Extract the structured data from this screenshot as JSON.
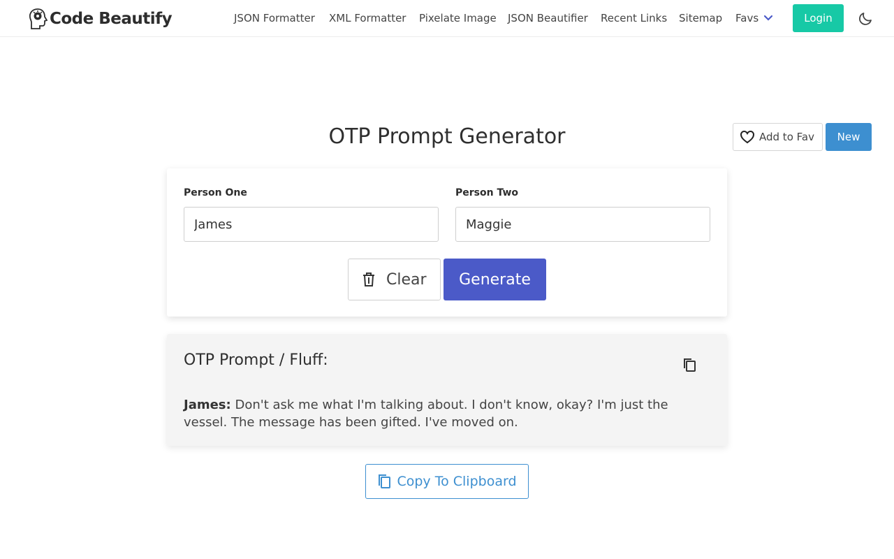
{
  "header": {
    "brand": "Code Beautify",
    "nav": [
      "JSON Formatter",
      "XML Formatter",
      "Pixelate Image",
      "JSON Beautifier",
      "Recent Links",
      "Sitemap",
      "Favs"
    ],
    "login_label": "Login",
    "icons": {
      "logo": "head-gear-logo-icon",
      "favs": "chevron-down-icon",
      "theme": "moon-icon"
    }
  },
  "page": {
    "title": "OTP Prompt Generator",
    "add_to_fav_label": "Add to Fav",
    "new_label": "New"
  },
  "form": {
    "person_one_label": "Person One",
    "person_one_value": "James",
    "person_two_label": "Person Two",
    "person_two_value": "Maggie",
    "clear_label": "Clear",
    "generate_label": "Generate"
  },
  "output": {
    "title": "OTP Prompt / Fluff:",
    "speaker": "James:",
    "text": "Don't ask me what I'm talking about. I don't know, okay? I'm just the vessel. The message has been gifted. I've moved on."
  },
  "copy_label": "Copy To Clipboard",
  "colors": {
    "login": "#17c9a6",
    "new": "#3d8fd0",
    "generate": "#4b5ac8",
    "copy": "#3d8fd0",
    "output_bg": "#f4f4f4"
  }
}
